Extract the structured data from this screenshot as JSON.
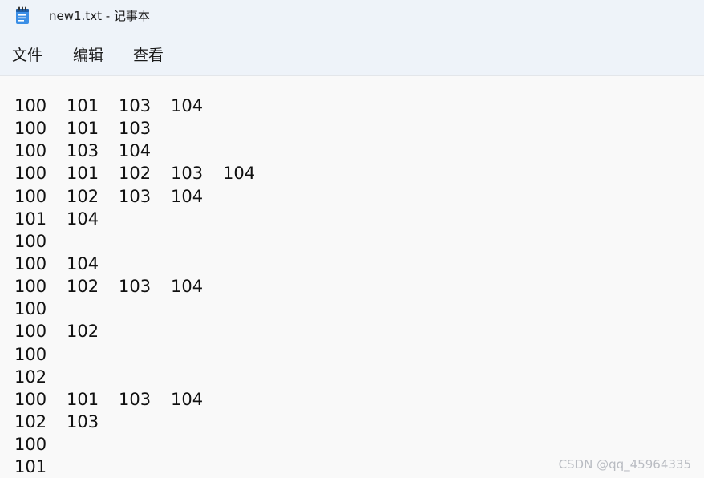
{
  "window": {
    "title": "new1.txt - 记事本",
    "app_icon": "notepad-icon"
  },
  "menu": {
    "file": "文件",
    "edit": "编辑",
    "view": "查看"
  },
  "editor": {
    "lines": [
      [
        "100",
        "101",
        "103",
        "104"
      ],
      [
        "100",
        "101",
        "103"
      ],
      [
        "100",
        "103",
        "104"
      ],
      [
        "100",
        "101",
        "102",
        "103",
        "104"
      ],
      [
        "100",
        "102",
        "103",
        "104"
      ],
      [
        "101",
        "104"
      ],
      [
        "100"
      ],
      [
        "100",
        "104"
      ],
      [
        "100",
        "102",
        "103",
        "104"
      ],
      [
        "100"
      ],
      [
        "100",
        "102"
      ],
      [
        "100"
      ],
      [
        "102"
      ],
      [
        "100",
        "101",
        "103",
        "104"
      ],
      [
        "102",
        "103"
      ],
      [
        "100"
      ],
      [
        "101"
      ]
    ]
  },
  "watermark": "CSDN @qq_45964335",
  "colors": {
    "chrome_bg": "#eef3f9",
    "editor_bg": "#f9f9f9",
    "text": "#111111",
    "icon_blue": "#2b7bd6"
  }
}
